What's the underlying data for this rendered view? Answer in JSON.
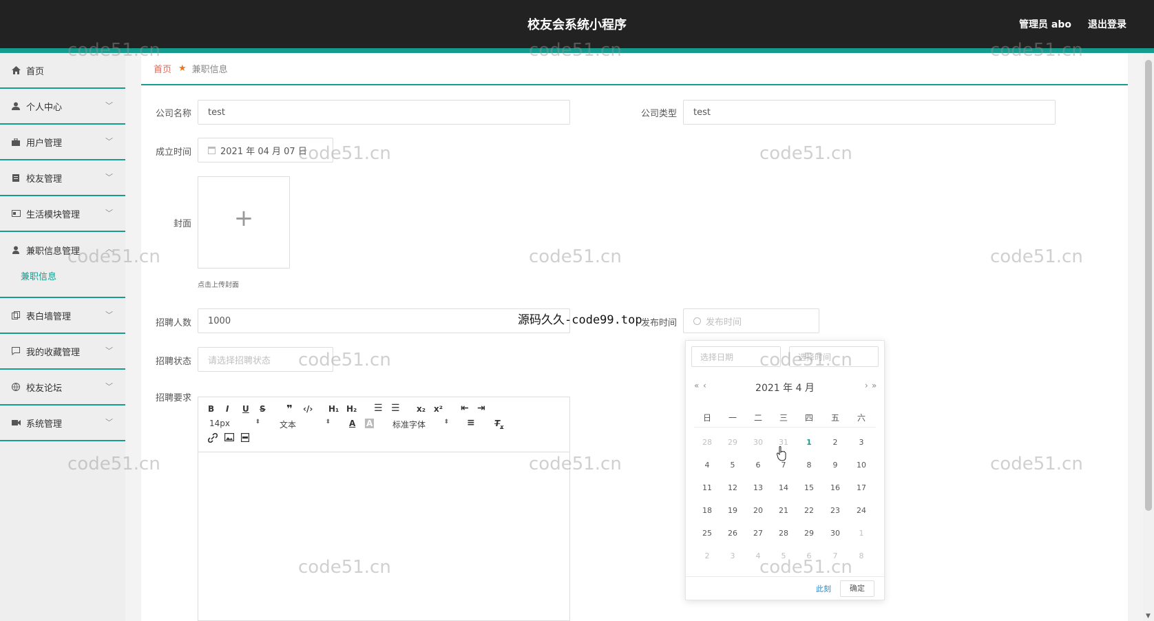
{
  "header": {
    "title": "校友会系统小程序",
    "admin": "管理员 abo",
    "logout": "退出登录"
  },
  "sidebar": {
    "items": [
      {
        "label": "首页",
        "icon": "home-icon"
      },
      {
        "label": "个人中心",
        "icon": "user-icon"
      },
      {
        "label": "用户管理",
        "icon": "briefcase-icon"
      },
      {
        "label": "校友管理",
        "icon": "clipboard-icon"
      },
      {
        "label": "生活模块管理",
        "icon": "card-icon"
      },
      {
        "label": "兼职信息管理",
        "icon": "person-icon"
      },
      {
        "label": "表白墙管理",
        "icon": "copy-icon"
      },
      {
        "label": "我的收藏管理",
        "icon": "chat-icon"
      },
      {
        "label": "校友论坛",
        "icon": "globe-icon"
      },
      {
        "label": "系统管理",
        "icon": "video-icon"
      }
    ],
    "sub_item": "兼职信息"
  },
  "breadcrumb": {
    "home": "首页",
    "current": "兼职信息"
  },
  "form": {
    "company_name_label": "公司名称",
    "company_name_value": "test",
    "company_type_label": "公司类型",
    "company_type_value": "test",
    "founded_label": "成立时间",
    "founded_value": "2021 年 04 月 07 日",
    "cover_label": "封面",
    "cover_hint": "点击上传封面",
    "recruit_count_label": "招聘人数",
    "recruit_count_value": "1000",
    "publish_time_label": "发布时间",
    "publish_time_placeholder": "发布时间",
    "recruit_status_label": "招聘状态",
    "recruit_status_placeholder": "请选择招聘状态",
    "requirements_label": "招聘要求"
  },
  "editor": {
    "font_size": "14px",
    "text_type": "文本",
    "font_family": "标准字体"
  },
  "picker": {
    "date_placeholder": "选择日期",
    "time_placeholder": "选择时间",
    "title": "2021 年  4 月",
    "weekdays": [
      "日",
      "一",
      "二",
      "三",
      "四",
      "五",
      "六"
    ],
    "weeks": [
      [
        "28",
        "29",
        "30",
        "31",
        "1",
        "2",
        "3"
      ],
      [
        "4",
        "5",
        "6",
        "7",
        "8",
        "9",
        "10"
      ],
      [
        "11",
        "12",
        "13",
        "14",
        "15",
        "16",
        "17"
      ],
      [
        "18",
        "19",
        "20",
        "21",
        "22",
        "23",
        "24"
      ],
      [
        "25",
        "26",
        "27",
        "28",
        "29",
        "30",
        "1"
      ],
      [
        "2",
        "3",
        "4",
        "5",
        "6",
        "7",
        "8"
      ]
    ],
    "today": "1",
    "now_label": "此刻",
    "ok_label": "确定"
  },
  "watermarks": {
    "site": "code51.cn",
    "center": "源码久久-code99.top"
  },
  "colors": {
    "accent": "#159c8f",
    "header_bg": "#222222",
    "breadcrumb_home": "#e06b5c"
  }
}
